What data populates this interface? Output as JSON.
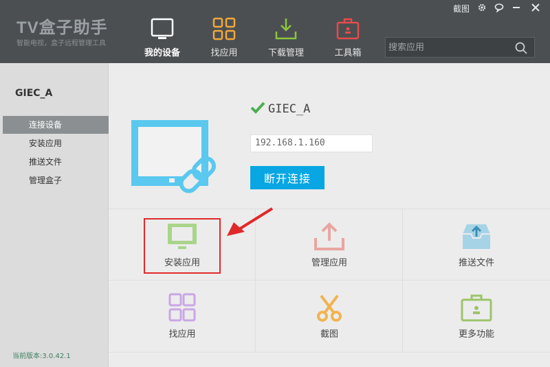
{
  "app": {
    "title": "TV盒子助手",
    "subtitle": "智能电视，盒子远程管理工具"
  },
  "nav": [
    {
      "label": "我的设备",
      "icon": "monitor-icon",
      "active": true
    },
    {
      "label": "找应用",
      "icon": "grid-icon"
    },
    {
      "label": "下载管理",
      "icon": "download-icon"
    },
    {
      "label": "工具箱",
      "icon": "toolbox-icon"
    }
  ],
  "search": {
    "placeholder": "搜索应用"
  },
  "window": {
    "screenshot": "截图"
  },
  "sidebar": {
    "device_name": "GIEC_A",
    "items": [
      {
        "label": "连接设备",
        "active": true
      },
      {
        "label": "安装应用"
      },
      {
        "label": "推送文件"
      },
      {
        "label": "管理盒子"
      }
    ],
    "version": "当前版本:3.0.42.1"
  },
  "device": {
    "name": "GIEC_A",
    "ip": "192.168.1.160",
    "disconnect_label": "断开连接"
  },
  "tiles": [
    {
      "label": "安装应用",
      "icon": "tv-icon"
    },
    {
      "label": "管理应用",
      "icon": "upload-icon"
    },
    {
      "label": "推送文件",
      "icon": "inbox-icon"
    },
    {
      "label": "找应用",
      "icon": "apps-grid-icon"
    },
    {
      "label": "截图",
      "icon": "scissors-icon"
    },
    {
      "label": "更多功能",
      "icon": "briefcase-icon"
    }
  ],
  "colors": {
    "topbar": "#4b4f52",
    "accent_blue": "#08a6e3",
    "highlight_red": "#e0292a",
    "check_green": "#4caf50"
  }
}
